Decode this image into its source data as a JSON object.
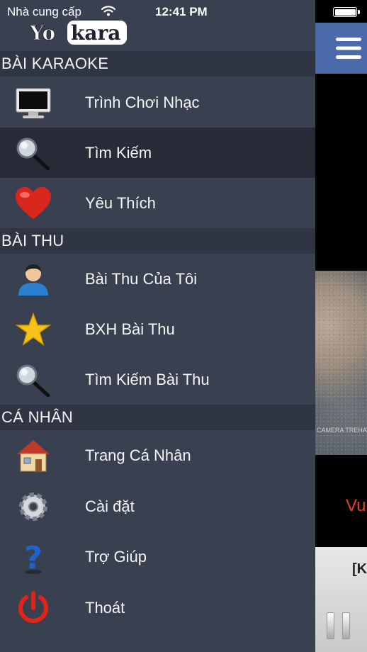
{
  "status_bar": {
    "carrier": "Nhà cung cấp",
    "time": "12:41 PM",
    "battery_level": 1.0
  },
  "app": {
    "logo": "Yokara"
  },
  "menu": {
    "sections": [
      {
        "title": "BÀI KARAOKE",
        "items": [
          {
            "label": "Trình Chơi Nhạc",
            "icon": "monitor-icon"
          },
          {
            "label": "Tìm Kiếm",
            "icon": "search-icon",
            "selected": true
          },
          {
            "label": "Yêu Thích",
            "icon": "heart-icon"
          }
        ]
      },
      {
        "title": "BÀI THU",
        "items": [
          {
            "label": "Bài Thu Của Tôi",
            "icon": "user-icon"
          },
          {
            "label": "BXH Bài Thu",
            "icon": "star-icon"
          },
          {
            "label": "Tìm Kiếm Bài Thu",
            "icon": "search-icon"
          }
        ]
      },
      {
        "title": "CÁ NHÂN",
        "items": [
          {
            "label": "Trang Cá Nhân",
            "icon": "house-icon"
          },
          {
            "label": "Cài đặt",
            "icon": "gear-icon"
          },
          {
            "label": "Trợ Giúp",
            "icon": "help-icon"
          },
          {
            "label": "Thoát",
            "icon": "power-icon"
          }
        ]
      }
    ]
  },
  "main": {
    "watermark": "CAMERA TREHAT",
    "lyric": "Vu",
    "player_title": "[K"
  },
  "colors": {
    "drawer_bg": "#394050",
    "section_bg": "#2f3542",
    "selected_bg": "#262b37",
    "navbar_bg": "#4a6aa9",
    "lyric": "#ee3b2e"
  }
}
